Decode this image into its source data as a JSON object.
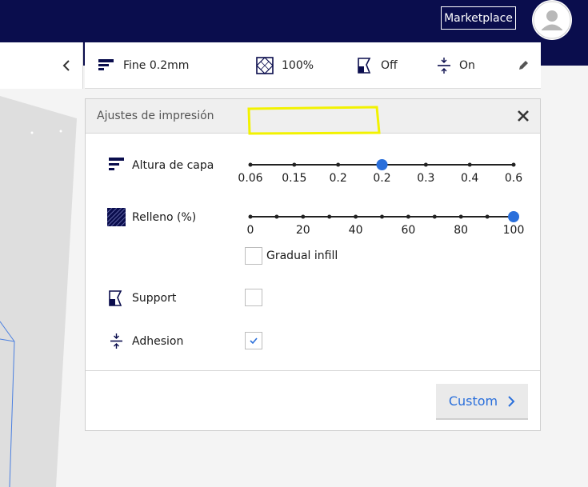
{
  "topbar": {
    "marketplace_label": "Marketplace",
    "colors": {
      "bg": "#0a0d4d",
      "text": "#ffffff"
    }
  },
  "settings_bar": {
    "quality_label": "Fine 0.2mm",
    "infill_label": "100%",
    "support_label": "Off",
    "adhesion_label": "On",
    "icons": [
      "layer-height-icon",
      "infill-icon",
      "support-icon",
      "adhesion-icon",
      "pencil-icon"
    ]
  },
  "panel": {
    "title": "Ajustes de impresión",
    "layer_height": {
      "label": "Altura de capa",
      "ticks": [
        "0.06",
        "0.15",
        "0.2",
        "0.2",
        "0.3",
        "0.4",
        "0.6"
      ],
      "selected_index": 3
    },
    "infill": {
      "label": "Relleno (%)",
      "tick_labels": [
        "0",
        "20",
        "40",
        "60",
        "80",
        "100"
      ],
      "steps": 11,
      "value": 100,
      "gradual_label": "Gradual infill",
      "gradual_checked": false
    },
    "support": {
      "label": "Support",
      "checked": false
    },
    "adhesion": {
      "label": "Adhesion",
      "checked": true
    },
    "custom_button_label": "Custom",
    "accent": "#2a6fdb"
  }
}
